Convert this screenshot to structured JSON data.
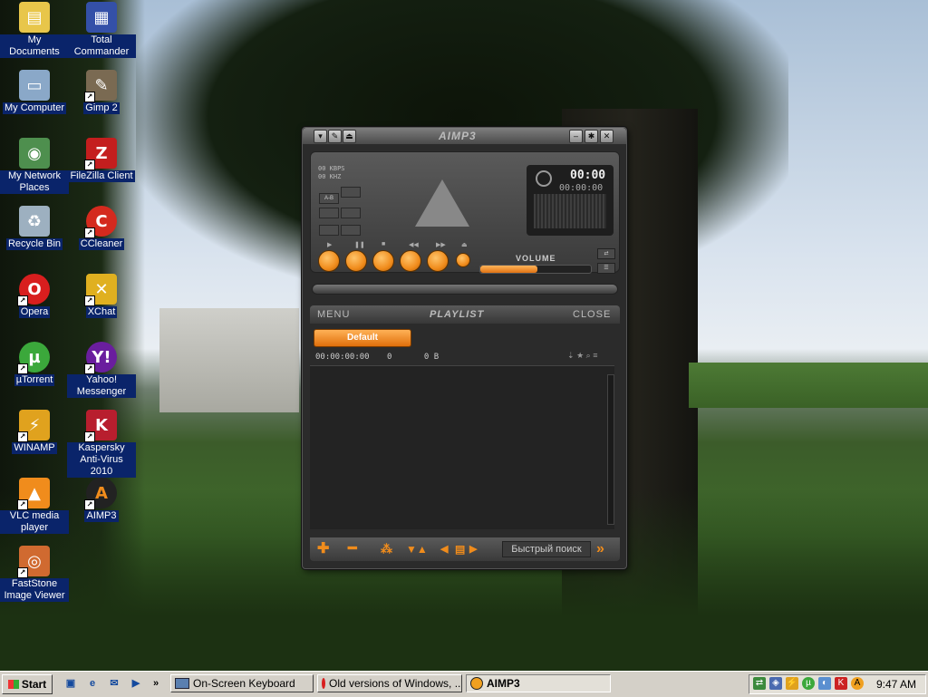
{
  "desktop": {
    "icons": [
      {
        "label": "My Documents",
        "icon": "folder-documents-icon"
      },
      {
        "label": "My Computer",
        "icon": "computer-icon"
      },
      {
        "label": "My Network Places",
        "icon": "network-places-icon"
      },
      {
        "label": "Recycle Bin",
        "icon": "recycle-bin-icon"
      },
      {
        "label": "Opera",
        "icon": "opera-icon"
      },
      {
        "label": "µTorrent",
        "icon": "utorrent-icon"
      },
      {
        "label": "WINAMP",
        "icon": "winamp-icon"
      },
      {
        "label": "VLC media player",
        "icon": "vlc-icon"
      },
      {
        "label": "FastStone Image Viewer",
        "icon": "faststone-icon"
      },
      {
        "label": "Total Commander",
        "icon": "total-commander-icon"
      },
      {
        "label": "Gimp 2",
        "icon": "gimp-icon"
      },
      {
        "label": "FileZilla Client",
        "icon": "filezilla-icon"
      },
      {
        "label": "CCleaner",
        "icon": "ccleaner-icon"
      },
      {
        "label": "XChat",
        "icon": "xchat-icon"
      },
      {
        "label": "Yahoo! Messenger",
        "icon": "yahoo-messenger-icon"
      },
      {
        "label": "Kaspersky Anti-Virus 2010",
        "icon": "kaspersky-icon"
      },
      {
        "label": "AIMP3",
        "icon": "aimp3-icon"
      }
    ]
  },
  "player": {
    "title": "AIMP3",
    "kbps": "KBPS",
    "khz": "KHZ",
    "kbps_value": "00",
    "khz_value": "00",
    "ab_label": "A-B",
    "time": "00:00",
    "time_total": "00:00:00",
    "volume_label": "VOLUME",
    "volume_level": 0.52,
    "accent": "#f08c1c"
  },
  "playlist": {
    "menu_label": "MENU",
    "title": "PLAYLIST",
    "close_label": "CLOSE",
    "tab": "Default",
    "duration": "00:00:00:00",
    "count": "0",
    "size": "0 B",
    "search_label": "Быстрый поиск"
  },
  "taskbar": {
    "start_label": "Start",
    "tasks": [
      {
        "label": "On-Screen Keyboard",
        "icon": "keyboard-icon"
      },
      {
        "label": "Old versions of Windows, ...",
        "icon": "opera-icon"
      },
      {
        "label": "AIMP3",
        "icon": "aimp3-icon"
      }
    ],
    "quick_launch_chevron": "»",
    "clock": "9:47 AM"
  }
}
